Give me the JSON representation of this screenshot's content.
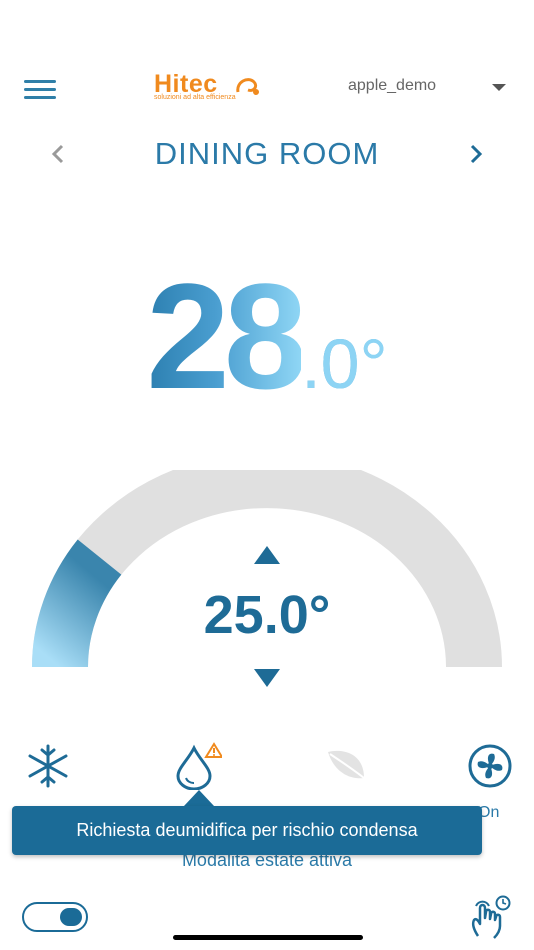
{
  "header": {
    "brand": "Hitec",
    "tagline": "soluzioni ad alta efficienza",
    "user": "apple_demo"
  },
  "room": {
    "name": "DINING ROOM"
  },
  "temperature": {
    "integer": "28",
    "decimal": ".0°"
  },
  "setpoint": {
    "value": "25.0°"
  },
  "gauge": {
    "level_fraction": 0.2
  },
  "modes": {
    "snow_icon": "snowflake-icon",
    "drop_icon": "water-drop-warning-icon",
    "leaf_icon": "leaf-icon",
    "fan_icon": "fan-icon",
    "fan_status_suffix": "On"
  },
  "tooltip": {
    "text": "Richiesta deumidifica per rischio condensa"
  },
  "status": {
    "summer_mode": "Modalita estate attiva"
  },
  "colors": {
    "accent": "#1b6b97",
    "brand": "#f08a1e",
    "gauge_track": "#e0e0e0"
  }
}
